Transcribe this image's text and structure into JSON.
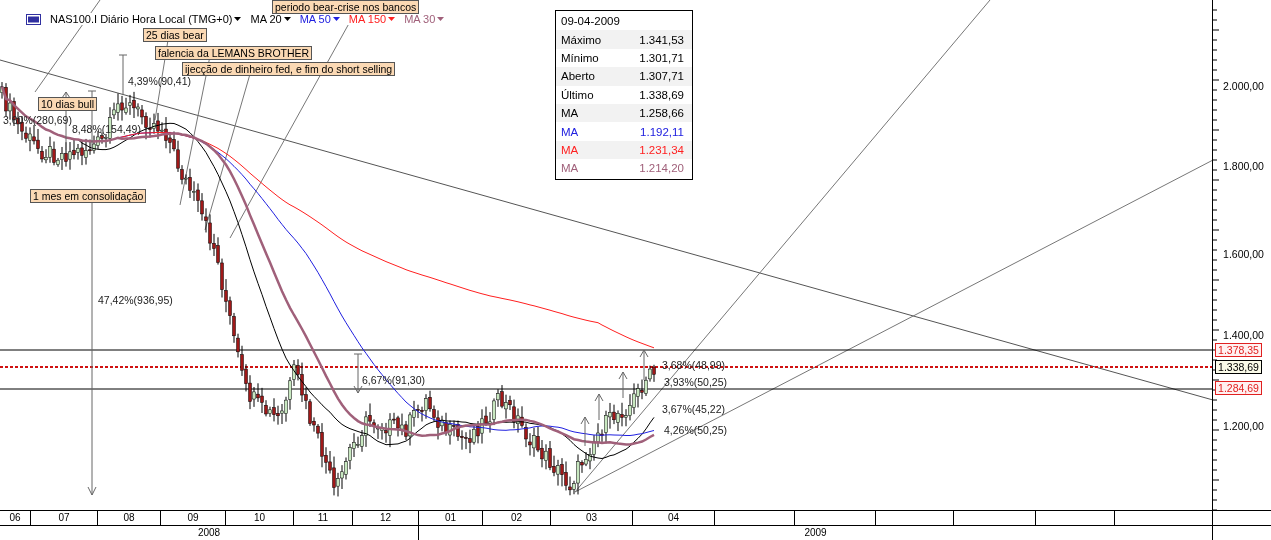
{
  "header": {
    "symbol": "NAS100.I Diário Hora Local (TMG+0)",
    "indicators": [
      {
        "label": "MA 20",
        "color": "#000000"
      },
      {
        "label": "MA 50",
        "color": "#2020e0"
      },
      {
        "label": "MA 150",
        "color": "#ff2020"
      },
      {
        "label": "MA 30",
        "color": "#a0607a"
      }
    ]
  },
  "info_box": {
    "date": "09-04-2009",
    "rows": [
      {
        "label": "Máximo",
        "value": "1.341,53",
        "color": "#000000"
      },
      {
        "label": "Mínimo",
        "value": "1.301,71",
        "color": "#000000"
      },
      {
        "label": "Aberto",
        "value": "1.307,71",
        "color": "#000000"
      },
      {
        "label": "Último",
        "value": "1.338,69",
        "color": "#000000"
      },
      {
        "label": "MA",
        "value": "1.258,66",
        "color": "#000000"
      },
      {
        "label": "MA",
        "value": "1.192,11",
        "color": "#2020e0"
      },
      {
        "label": "MA",
        "value": "1.231,34",
        "color": "#ff2020"
      },
      {
        "label": "MA",
        "value": "1.214,20",
        "color": "#a0607a"
      }
    ]
  },
  "annotations": [
    {
      "kind": "note",
      "text": "periodo bear-crise nos bancos"
    },
    {
      "kind": "note",
      "text": "25 dias bear"
    },
    {
      "kind": "note",
      "text": "falencia da LEMANS BROTHER"
    },
    {
      "kind": "note",
      "text": "ijecção de dinheiro fed, e fim do short selling"
    },
    {
      "kind": "note",
      "text": "10 dias bull"
    },
    {
      "kind": "note",
      "text": "1 mes em consolidação"
    },
    {
      "kind": "measure",
      "text": "4,39%(90,41)"
    },
    {
      "kind": "measure",
      "text": "3,60%(280,69)"
    },
    {
      "kind": "measure",
      "text": "8,48%(154,49)"
    },
    {
      "kind": "measure",
      "text": "47,42%(936,95)"
    },
    {
      "kind": "measure",
      "text": "6,67%(91,30)"
    },
    {
      "kind": "measure",
      "text": "3,68%(48,99)"
    },
    {
      "kind": "measure",
      "text": "3,93%(50,25)"
    },
    {
      "kind": "measure",
      "text": "3,67%(45,22)"
    },
    {
      "kind": "measure",
      "text": "4,26%(50,25)"
    }
  ],
  "price_axis": {
    "ticks": [
      "2.000,00",
      "1.800,00",
      "1.600,00",
      "1.400,00",
      "1.200,00"
    ],
    "labels": [
      {
        "text": "1.378,35",
        "color": "#e02020"
      },
      {
        "text": "1.338,69",
        "color": "#000000"
      },
      {
        "text": "1.284,69",
        "color": "#e02020"
      }
    ]
  },
  "time_axis": {
    "months": [
      "06",
      "07",
      "08",
      "09",
      "10",
      "11",
      "12",
      "01",
      "02",
      "03",
      "04"
    ],
    "years": [
      "2008",
      "2009"
    ]
  }
}
